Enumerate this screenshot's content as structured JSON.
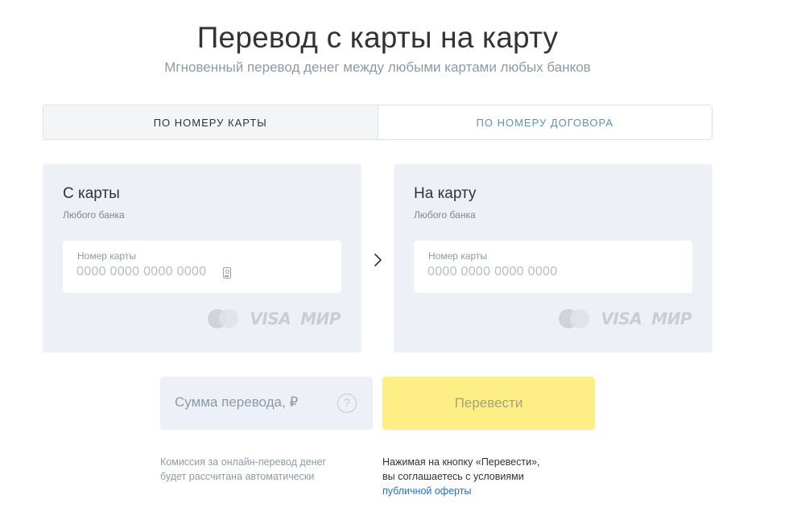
{
  "page": {
    "title": "Перевод с карты на карту",
    "subtitle": "Мгновенный перевод денег между любыми картами любых банков"
  },
  "tabs": [
    {
      "label": "ПО НОМЕРУ КАРТЫ",
      "active": true
    },
    {
      "label": "ПО НОМЕРУ ДОГОВОРА",
      "active": false
    }
  ],
  "from_card": {
    "title": "С карты",
    "subtitle": "Любого банка",
    "input_label": "Номер карты",
    "placeholder": "0000 0000 0000 0000",
    "icon": "card-scan-icon"
  },
  "to_card": {
    "title": "На карту",
    "subtitle": "Любого банка",
    "input_label": "Номер карты",
    "placeholder": "0000 0000 0000 0000"
  },
  "brands": {
    "visa": "VISA",
    "mir": "МИР",
    "mastercard_icon": "mastercard-icon"
  },
  "arrow_icon": "chevron-right-icon",
  "amount": {
    "placeholder": "Сумма перевода, ₽",
    "help_icon": "?"
  },
  "submit": {
    "label": "Перевести"
  },
  "commission": {
    "line1": "Комиссия за онлайн-перевод денег",
    "line2": "будет рассчитана автоматически"
  },
  "agreement": {
    "line1": "Нажимая на кнопку «Перевести»,",
    "line2": "вы соглашаетесь с условиями",
    "link": "публичной оферты"
  },
  "colors": {
    "accent_yellow": "#fdef85",
    "panel_bg": "#edf0f7",
    "link_blue": "#1e73be",
    "tab_inactive": "#5f91b8"
  }
}
